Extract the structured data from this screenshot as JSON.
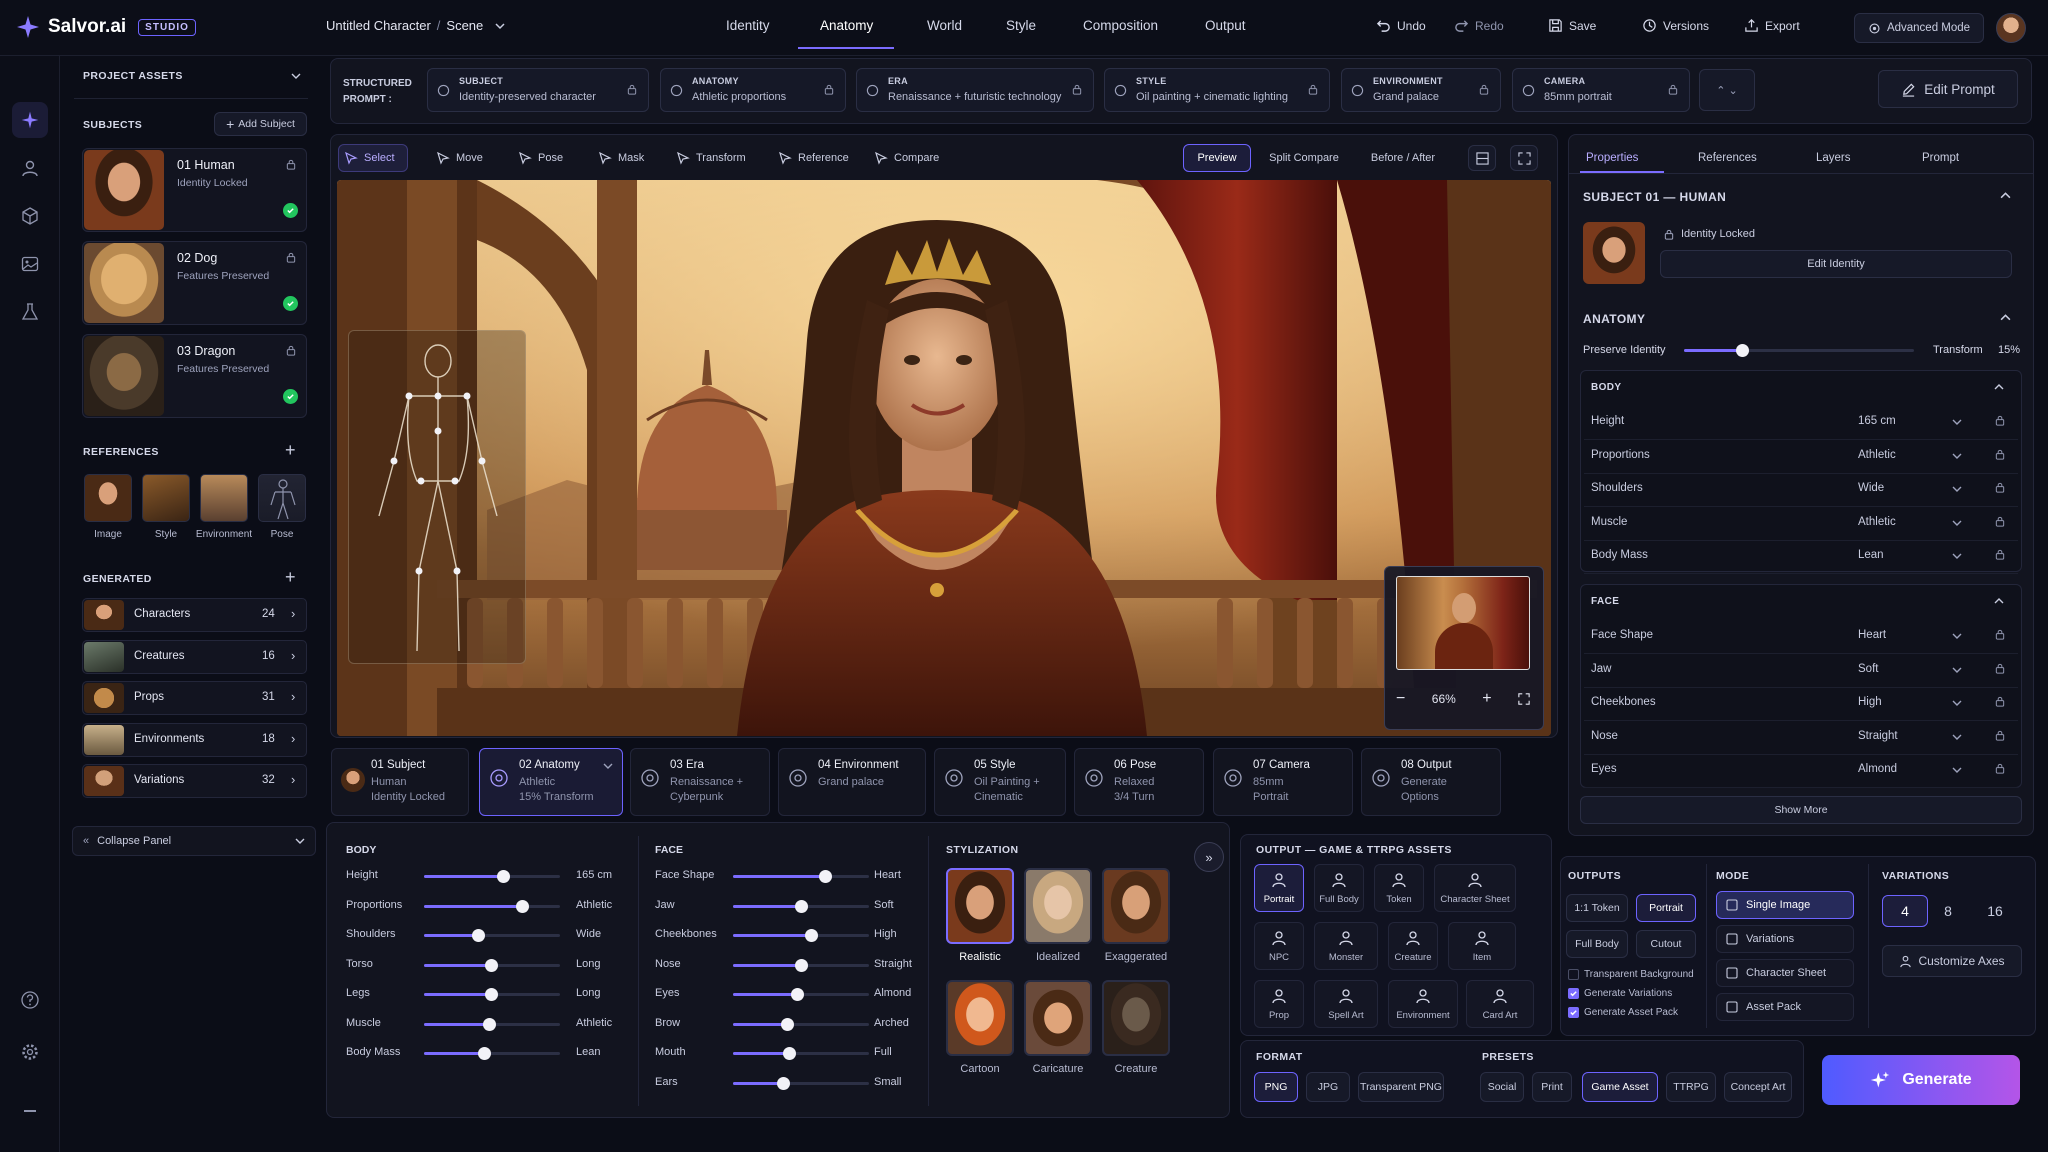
{
  "app": {
    "name": "Salvor.ai",
    "badge": "STUDIO",
    "doc_title": "Untitled Character",
    "doc_scene": "Scene",
    "sep": "/"
  },
  "nav": {
    "tabs": [
      "Identity",
      "Anatomy",
      "World",
      "Style",
      "Composition",
      "Output"
    ],
    "active": 1
  },
  "header_actions": {
    "undo": "Undo",
    "redo": "Redo",
    "save": "Save",
    "versions": "Versions",
    "export": "Export",
    "advanced": "Advanced Mode"
  },
  "left": {
    "project_assets": "PROJECT ASSETS",
    "subjects_title": "SUBJECTS",
    "add_subject": "Add Subject",
    "subjects": [
      {
        "name": "01  Human",
        "status": "Identity Locked"
      },
      {
        "name": "02  Dog",
        "status": "Features Preserved"
      },
      {
        "name": "03  Dragon",
        "status": "Features Preserved"
      }
    ],
    "references_title": "REFERENCES",
    "references": [
      "Image",
      "Style",
      "Environment",
      "Pose"
    ],
    "generated_title": "GENERATED",
    "generated": [
      {
        "label": "Characters",
        "count": "24"
      },
      {
        "label": "Creatures",
        "count": "16"
      },
      {
        "label": "Props",
        "count": "31"
      },
      {
        "label": "Environments",
        "count": "18"
      },
      {
        "label": "Variations",
        "count": "32"
      }
    ],
    "collapse": "Collapse Panel"
  },
  "prompt_bar": {
    "label1": "STRUCTURED",
    "label2": "PROMPT :",
    "chips": [
      {
        "k": "SUBJECT",
        "v": "Identity-preserved character"
      },
      {
        "k": "ANATOMY",
        "v": "Athletic proportions"
      },
      {
        "k": "ERA",
        "v": "Renaissance + futuristic technology"
      },
      {
        "k": "STYLE",
        "v": "Oil painting + cinematic lighting"
      },
      {
        "k": "ENVIRONMENT",
        "v": "Grand palace"
      },
      {
        "k": "CAMERA",
        "v": "85mm portrait"
      }
    ],
    "edit": "Edit Prompt"
  },
  "toolbar": {
    "tools": [
      "Select",
      "Move",
      "Pose",
      "Mask",
      "Transform",
      "Reference",
      "Compare"
    ],
    "views": [
      "Preview",
      "Split Compare",
      "Before / After"
    ],
    "zoom": "66%"
  },
  "steps": [
    {
      "t": "01 Subject",
      "a": "Human",
      "b": "Identity Locked"
    },
    {
      "t": "02 Anatomy",
      "a": "Athletic",
      "b": "15% Transform"
    },
    {
      "t": "03 Era",
      "a": "Renaissance +",
      "b": "Cyberpunk"
    },
    {
      "t": "04 Environment",
      "a": "Grand palace",
      "b": ""
    },
    {
      "t": "05 Style",
      "a": "Oil Painting +",
      "b": "Cinematic"
    },
    {
      "t": "06 Pose",
      "a": "Relaxed",
      "b": "3/4 Turn"
    },
    {
      "t": "07 Camera",
      "a": "85mm",
      "b": "Portrait"
    },
    {
      "t": "08 Output",
      "a": "Generate",
      "b": "Options"
    }
  ],
  "body_sliders": {
    "title": "BODY",
    "items": [
      {
        "l": "Height",
        "v": "165 cm",
        "p": 0.58
      },
      {
        "l": "Proportions",
        "v": "Athletic",
        "p": 0.72
      },
      {
        "l": "Shoulders",
        "v": "Wide",
        "p": 0.4
      },
      {
        "l": "Torso",
        "v": "Long",
        "p": 0.49
      },
      {
        "l": "Legs",
        "v": "Long",
        "p": 0.49
      },
      {
        "l": "Muscle",
        "v": "Athletic",
        "p": 0.48
      },
      {
        "l": "Body Mass",
        "v": "Lean",
        "p": 0.44
      }
    ]
  },
  "face_sliders": {
    "title": "FACE",
    "items": [
      {
        "l": "Face Shape",
        "v": "Heart",
        "p": 0.68
      },
      {
        "l": "Jaw",
        "v": "Soft",
        "p": 0.5
      },
      {
        "l": "Cheekbones",
        "v": "High",
        "p": 0.57
      },
      {
        "l": "Nose",
        "v": "Straight",
        "p": 0.5
      },
      {
        "l": "Eyes",
        "v": "Almond",
        "p": 0.47
      },
      {
        "l": "Brow",
        "v": "Arched",
        "p": 0.4
      },
      {
        "l": "Mouth",
        "v": "Full",
        "p": 0.41
      },
      {
        "l": "Ears",
        "v": "Small",
        "p": 0.37
      }
    ]
  },
  "stylization": {
    "title": "STYLIZATION",
    "items": [
      "Realistic",
      "Idealized",
      "Exaggerated",
      "Cartoon",
      "Caricature",
      "Creature"
    ]
  },
  "output_assets": {
    "title": "OUTPUT — GAME & TTRPG ASSETS",
    "items": [
      "Portrait",
      "Full Body",
      "Token",
      "Character Sheet",
      "NPC",
      "Monster",
      "Creature",
      "Item",
      "Prop",
      "Spell Art",
      "Environment",
      "Card Art"
    ]
  },
  "format": {
    "title": "FORMAT",
    "items": [
      "PNG",
      "JPG",
      "Transparent PNG"
    ]
  },
  "presets": {
    "title": "PRESETS",
    "items": [
      "Social",
      "Print",
      "Game Asset",
      "TTRPG",
      "Concept Art"
    ]
  },
  "outputs": {
    "title": "OUTPUTS",
    "items": [
      "1:1 Token",
      "Portrait",
      "Full Body",
      "Cutout"
    ],
    "checks": [
      {
        "l": "Transparent Background",
        "on": false
      },
      {
        "l": "Generate Variations",
        "on": true
      },
      {
        "l": "Generate Asset Pack",
        "on": true
      }
    ]
  },
  "mode": {
    "title": "MODE",
    "items": [
      "Single Image",
      "Variations",
      "Character Sheet",
      "Asset Pack"
    ]
  },
  "variations": {
    "title": "VARIATIONS",
    "items": [
      "4",
      "8",
      "16"
    ],
    "customize": "Customize Axes"
  },
  "generate": "Generate",
  "right": {
    "tabs": [
      "Properties",
      "References",
      "Layers",
      "Prompt"
    ],
    "subject_title": "SUBJECT 01 — HUMAN",
    "identity_locked": "Identity Locked",
    "edit_identity": "Edit Identity",
    "anatomy_title": "ANATOMY",
    "preserve": "Preserve Identity",
    "transform": "Transform",
    "transform_val": "15%",
    "preserve_ratio": 0.25,
    "body_title": "BODY",
    "body": [
      {
        "l": "Height",
        "v": "165 cm"
      },
      {
        "l": "Proportions",
        "v": "Athletic"
      },
      {
        "l": "Shoulders",
        "v": "Wide"
      },
      {
        "l": "Muscle",
        "v": "Athletic"
      },
      {
        "l": "Body Mass",
        "v": "Lean"
      }
    ],
    "face_title": "FACE",
    "face": [
      {
        "l": "Face Shape",
        "v": "Heart"
      },
      {
        "l": "Jaw",
        "v": "Soft"
      },
      {
        "l": "Cheekbones",
        "v": "High"
      },
      {
        "l": "Nose",
        "v": "Straight"
      },
      {
        "l": "Eyes",
        "v": "Almond"
      }
    ],
    "show_more": "Show More"
  },
  "colors": {
    "accent": "#7b6cff",
    "bg": "#0b0d17",
    "panel": "#12141f",
    "success": "#22c55e",
    "generate_from": "#4f5bff",
    "generate_to": "#b455e8"
  }
}
